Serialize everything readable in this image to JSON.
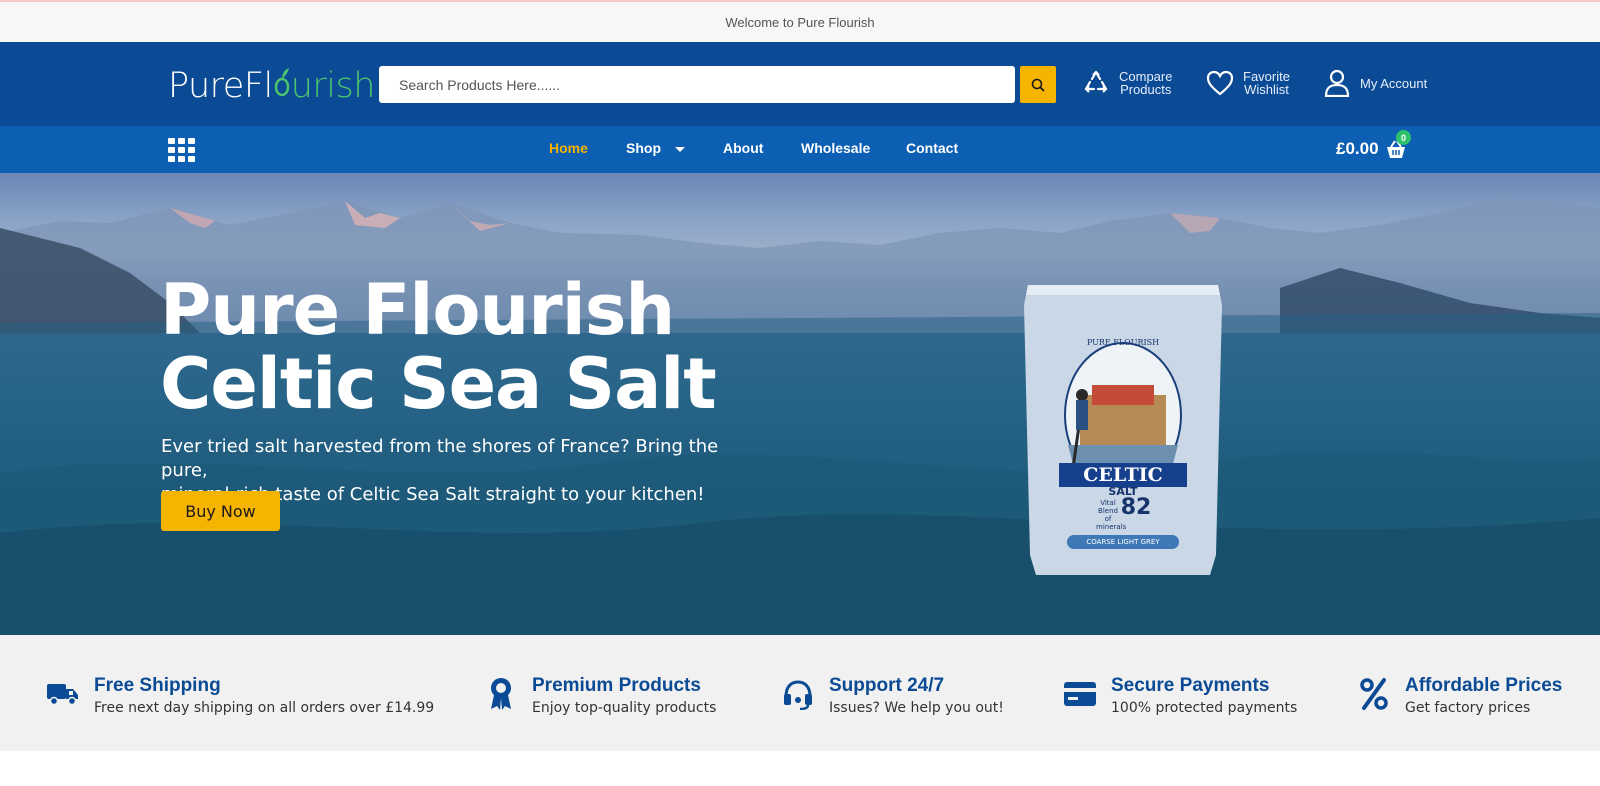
{
  "topbar": {
    "welcome": "Welcome to Pure Flourish"
  },
  "header": {
    "logo_part1": "PureFl",
    "logo_part2": "urish",
    "search": {
      "placeholder": "Search Products Here......",
      "value": ""
    },
    "compare": {
      "line1": "Compare",
      "line2": "Products"
    },
    "wishlist": {
      "line1": "Favorite",
      "line2": "Wishlist"
    },
    "account": {
      "label": "My Account"
    }
  },
  "nav": {
    "items": [
      {
        "label": "Home"
      },
      {
        "label": "Shop"
      },
      {
        "label": "About"
      },
      {
        "label": "Wholesale"
      },
      {
        "label": "Contact"
      }
    ],
    "cart_total": "£0.00",
    "cart_count": "0"
  },
  "hero": {
    "title_line1": "Pure Flourish",
    "title_line2": "Celtic Sea Salt",
    "subtitle_line1": "Ever tried salt harvested from the shores of France? Bring the pure,",
    "subtitle_line2": "mineral-rich taste of Celtic Sea Salt straight to your kitchen!",
    "cta": "Buy Now",
    "product": {
      "brand": "PURE FLOURISH",
      "name": "CELTIC",
      "type": "SALT",
      "blend_text": "Vital Blend of minerals",
      "blend_number": "82",
      "variant": "COARSE LIGHT GREY"
    }
  },
  "features": [
    {
      "title": "Free Shipping",
      "desc": "Free next day shipping on all orders over £14.99",
      "icon": "truck-icon"
    },
    {
      "title": "Premium Products",
      "desc": "Enjoy top-quality products",
      "icon": "award-icon"
    },
    {
      "title": "Support 24/7",
      "desc": "Issues? We help you out!",
      "icon": "headset-icon"
    },
    {
      "title": "Secure Payments",
      "desc": "100% protected payments",
      "icon": "credit-card-icon"
    },
    {
      "title": "Affordable Prices",
      "desc": "Get factory prices",
      "icon": "percent-icon"
    }
  ],
  "colors": {
    "primary": "#0b4a94",
    "nav": "#0c5fb2",
    "accent": "#f5b400",
    "green": "#4cc46d"
  }
}
